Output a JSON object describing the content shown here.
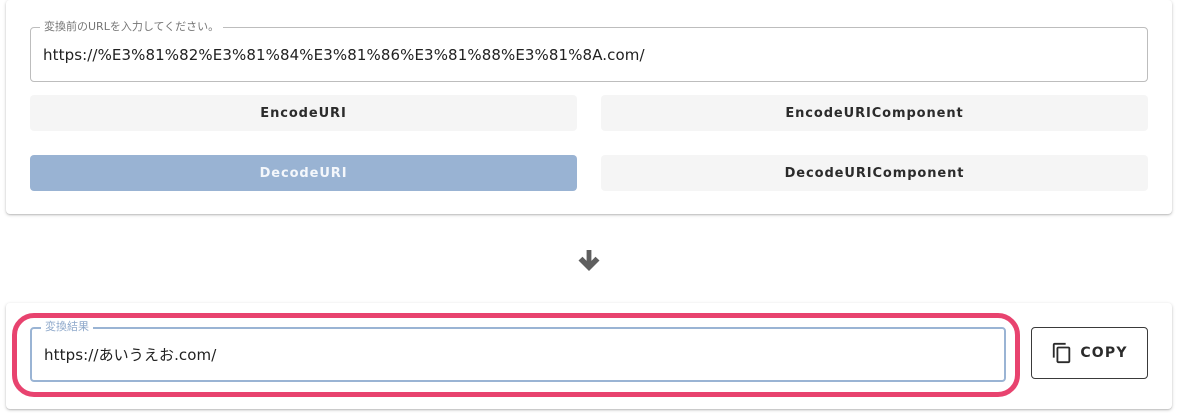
{
  "input_section": {
    "label": "変換前のURLを入力してください。",
    "value": "https://%E3%81%82%E3%81%84%E3%81%86%E3%81%88%E3%81%8A.com/"
  },
  "buttons": {
    "encode_uri": "EncodeURI",
    "encode_uri_component": "EncodeURIComponent",
    "decode_uri": "DecodeURI",
    "decode_uri_component": "DecodeURIComponent",
    "active": "decode_uri"
  },
  "arrow_icon": "arrow-down-icon",
  "output_section": {
    "label": "変換結果",
    "value": "https://あいうえお.com/",
    "copy_label": "COPY",
    "copy_icon": "copy-icon"
  },
  "colors": {
    "active_button": "#99b3d3",
    "highlight_border": "#e8436f",
    "focused_field_border": "#9ab4d4"
  }
}
